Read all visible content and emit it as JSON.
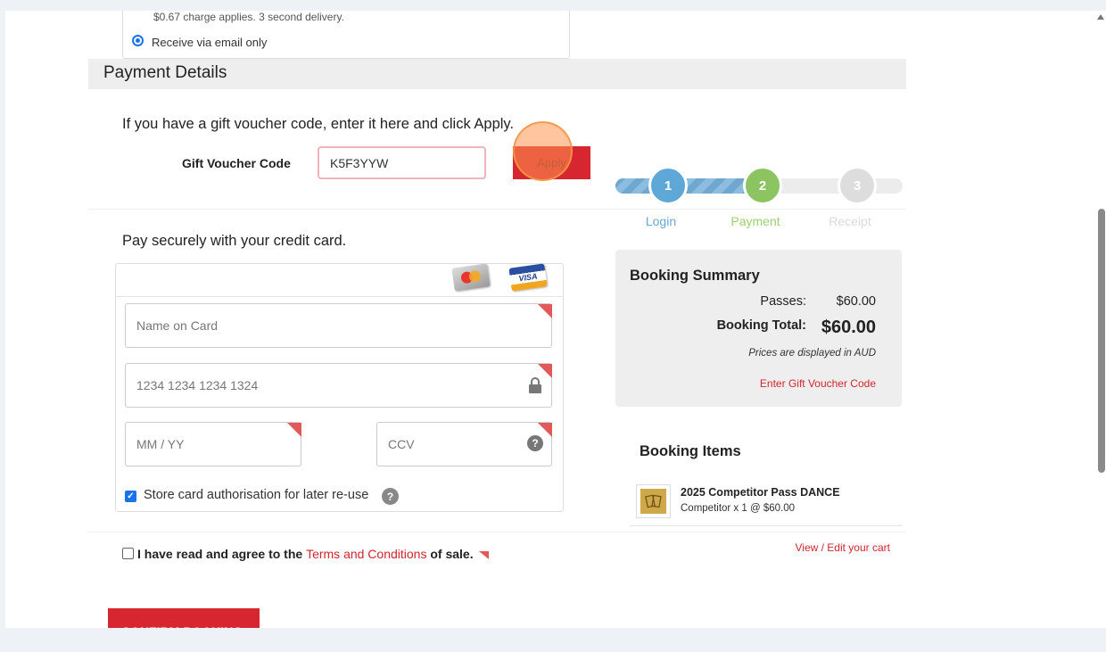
{
  "delivery": {
    "sms_note": "$0.67 charge applies. 3 second delivery.",
    "email_option_label": "Receive via email only"
  },
  "payment_details": {
    "section_title": "Payment Details",
    "voucher_intro": "If you have a gift voucher code, enter it here and click Apply.",
    "voucher_label": "Gift Voucher Code",
    "voucher_value": "K5F3YYW",
    "apply_label": "Apply"
  },
  "steps": [
    {
      "number": "1",
      "label": "Login"
    },
    {
      "number": "2",
      "label": "Payment"
    },
    {
      "number": "3",
      "label": "Receipt"
    }
  ],
  "card_form": {
    "intro": "Pay securely with your credit card.",
    "name_placeholder": "Name on Card",
    "number_placeholder": "1234 1234 1234 1324",
    "expiry_placeholder": "MM / YY",
    "ccv_placeholder": "CCV",
    "visa_text": "VISA",
    "store_label": "Store card authorisation for later re-use",
    "help_glyph": "?"
  },
  "terms": {
    "prefix": "I have read and agree to the ",
    "link": "Terms and Conditions",
    "suffix": " of sale."
  },
  "confirm_label": "CONFIRM BOOKING",
  "summary": {
    "title": "Booking Summary",
    "passes_label": "Passes:",
    "passes_value": "$60.00",
    "total_label": "Booking Total:",
    "total_value": "$60.00",
    "currency_note": "Prices are displayed in AUD",
    "gift_link": "Enter Gift Voucher Code"
  },
  "booking_items": {
    "title": "Booking Items",
    "items": [
      {
        "name": "2025 Competitor Pass DANCE",
        "detail": "Competitor x 1 @ $60.00"
      }
    ],
    "cart_link": "View / Edit your cart"
  },
  "colors": {
    "accent_red": "#d7262f",
    "step_login": "#5ea8d7",
    "step_payment": "#8dc462",
    "step_receipt": "#dddddd"
  }
}
